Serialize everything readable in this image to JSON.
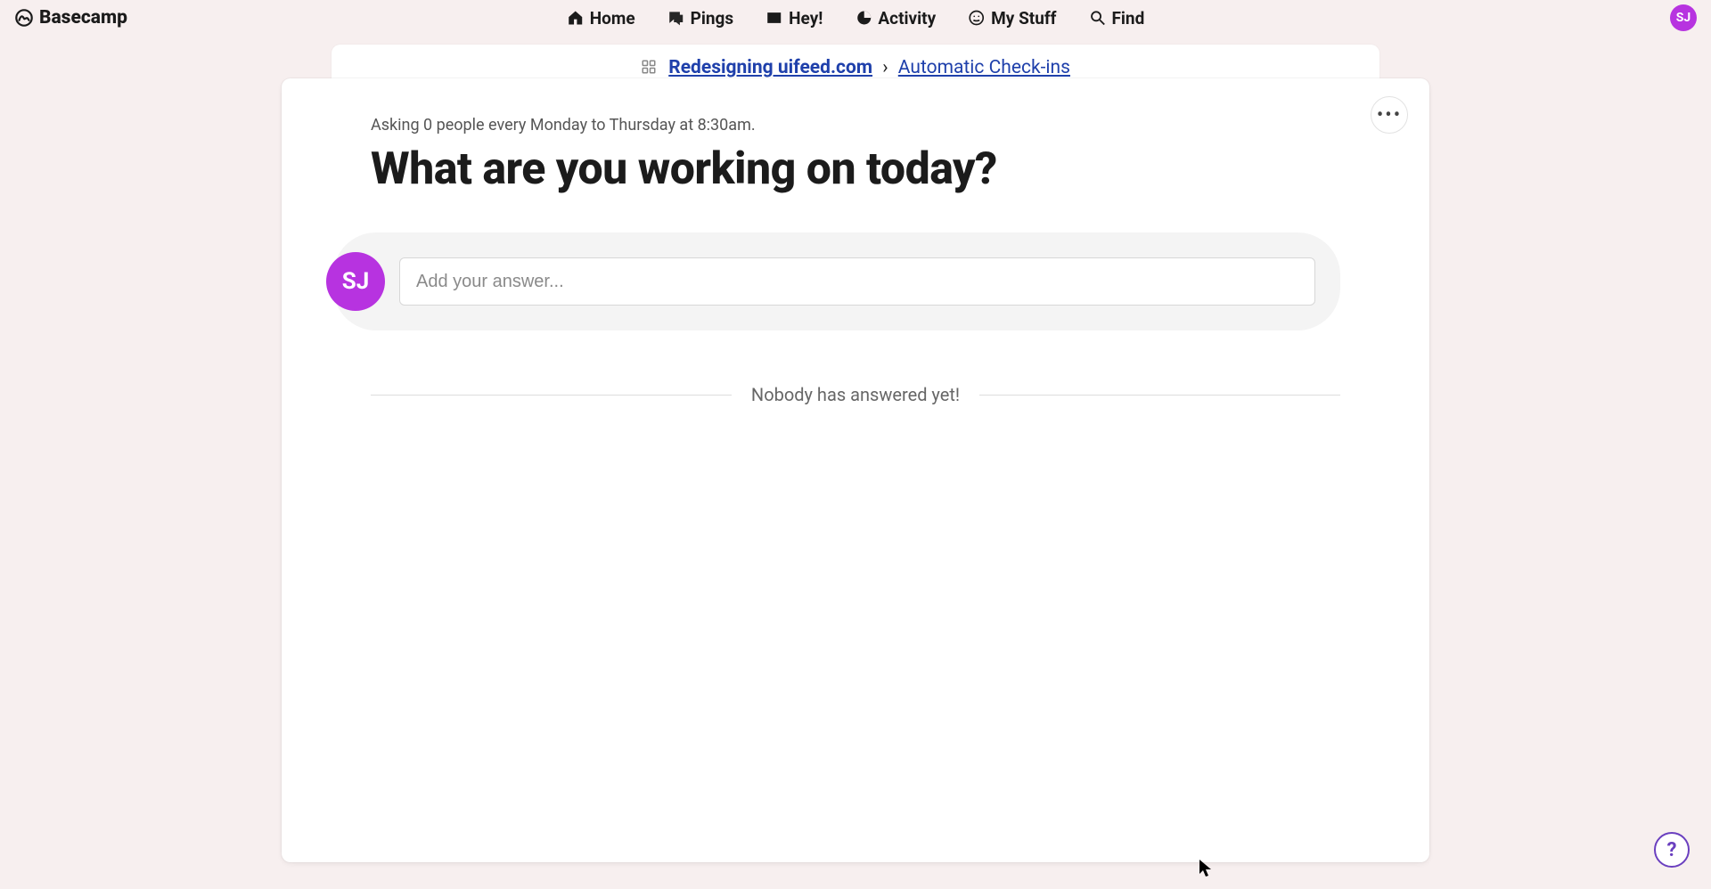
{
  "brand": {
    "name": "Basecamp"
  },
  "nav": {
    "home": "Home",
    "pings": "Pings",
    "hey": "Hey!",
    "activity": "Activity",
    "mystuff": "My Stuff",
    "find": "Find"
  },
  "user": {
    "initials": "SJ"
  },
  "breadcrumb": {
    "project": "Redesigning uifeed.com",
    "separator": "›",
    "section": "Automatic Check-ins"
  },
  "checkin": {
    "schedule": "Asking 0 people every Monday to Thursday at 8:30am.",
    "question": "What are you working on today?",
    "answer_placeholder": "Add your answer...",
    "empty_state": "Nobody has answered yet!"
  },
  "more_label": "•••",
  "help_label": "?"
}
